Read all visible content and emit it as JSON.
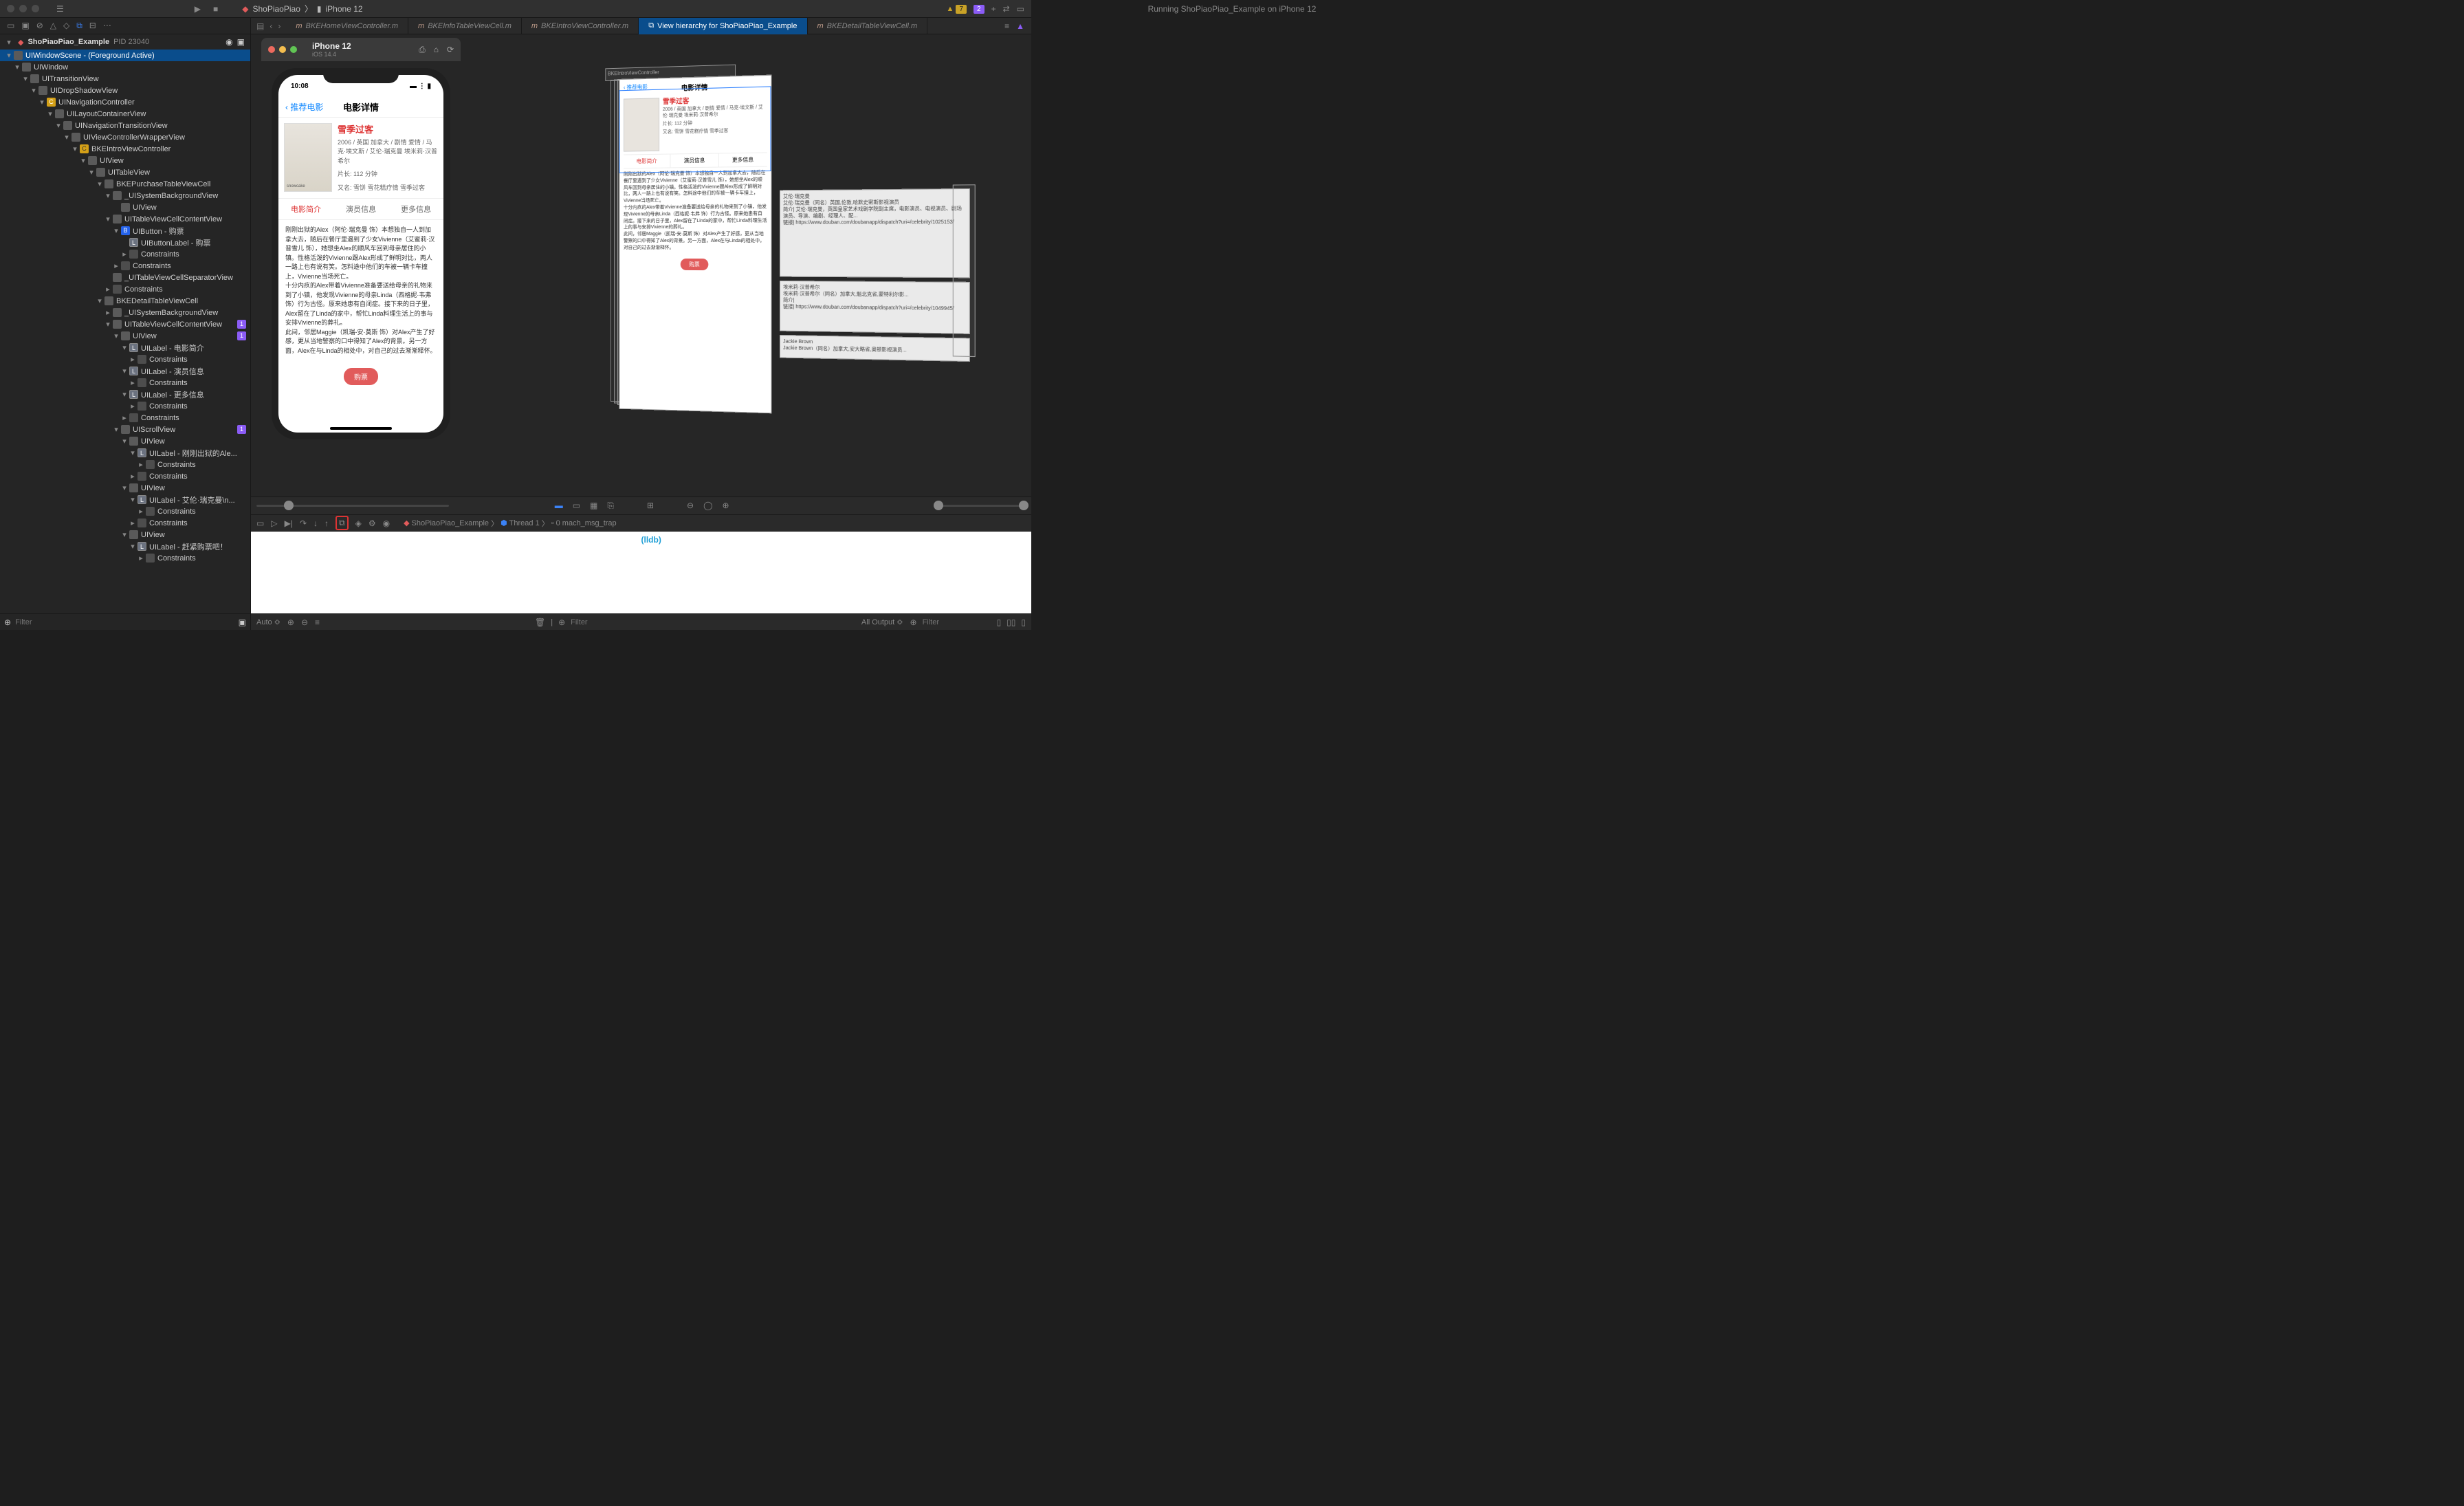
{
  "titlebar": {
    "target_app": "ShoPiaoPiao",
    "target_device": "iPhone 12",
    "status": "Running ShoPiaoPiao_Example on iPhone 12",
    "warning_count": "7",
    "issue_count": "2"
  },
  "sidebar": {
    "process": "ShoPiaoPiao_Example",
    "pid": "PID 23040",
    "tree": [
      {
        "d": 0,
        "disc": "▾",
        "ic": "v",
        "t": "UIWindowScene - (Foreground Active)",
        "sel": true
      },
      {
        "d": 1,
        "disc": "▾",
        "ic": "v",
        "t": "UIWindow"
      },
      {
        "d": 2,
        "disc": "▾",
        "ic": "v",
        "t": "UITransitionView"
      },
      {
        "d": 3,
        "disc": "▾",
        "ic": "v",
        "t": "UIDropShadowView"
      },
      {
        "d": 4,
        "disc": "▾",
        "ic": "n",
        "t": "UINavigationController"
      },
      {
        "d": 5,
        "disc": "▾",
        "ic": "v",
        "t": "UILayoutContainerView"
      },
      {
        "d": 6,
        "disc": "▾",
        "ic": "v",
        "t": "UINavigationTransitionView"
      },
      {
        "d": 7,
        "disc": "▾",
        "ic": "v",
        "t": "UIViewControllerWrapperView"
      },
      {
        "d": 8,
        "disc": "▾",
        "ic": "c",
        "t": "BKEIntroViewController"
      },
      {
        "d": 9,
        "disc": "▾",
        "ic": "v",
        "t": "UIView"
      },
      {
        "d": 10,
        "disc": "▾",
        "ic": "v",
        "t": "UITableView"
      },
      {
        "d": 11,
        "disc": "▾",
        "ic": "v",
        "t": "BKEPurchaseTableViewCell"
      },
      {
        "d": 12,
        "disc": "▾",
        "ic": "v",
        "t": "_UISystemBackgroundView"
      },
      {
        "d": 13,
        "disc": "",
        "ic": "v",
        "t": "UIView"
      },
      {
        "d": 12,
        "disc": "▾",
        "ic": "v",
        "t": "UITableViewCellContentView"
      },
      {
        "d": 13,
        "disc": "▾",
        "ic": "b",
        "t": "UIButton - 购票"
      },
      {
        "d": 14,
        "disc": "",
        "ic": "l",
        "t": "UIButtonLabel - 购票"
      },
      {
        "d": 14,
        "disc": "▸",
        "ic": "co",
        "t": "Constraints"
      },
      {
        "d": 13,
        "disc": "▸",
        "ic": "co",
        "t": "Constraints"
      },
      {
        "d": 12,
        "disc": "",
        "ic": "v",
        "t": "_UITableViewCellSeparatorView"
      },
      {
        "d": 12,
        "disc": "▸",
        "ic": "co",
        "t": "Constraints"
      },
      {
        "d": 11,
        "disc": "▾",
        "ic": "v",
        "t": "BKEDetailTableViewCell"
      },
      {
        "d": 12,
        "disc": "▸",
        "ic": "v",
        "t": "_UISystemBackgroundView"
      },
      {
        "d": 12,
        "disc": "▾",
        "ic": "v",
        "t": "UITableViewCellContentView",
        "badge": "1"
      },
      {
        "d": 13,
        "disc": "▾",
        "ic": "v",
        "t": "UIView",
        "badge": "1"
      },
      {
        "d": 14,
        "disc": "▾",
        "ic": "l",
        "t": "UILabel - 电影简介"
      },
      {
        "d": 15,
        "disc": "▸",
        "ic": "co",
        "t": "Constraints"
      },
      {
        "d": 14,
        "disc": "▾",
        "ic": "l",
        "t": "UILabel - 演员信息"
      },
      {
        "d": 15,
        "disc": "▸",
        "ic": "co",
        "t": "Constraints"
      },
      {
        "d": 14,
        "disc": "▾",
        "ic": "l",
        "t": "UILabel - 更多信息"
      },
      {
        "d": 15,
        "disc": "▸",
        "ic": "co",
        "t": "Constraints"
      },
      {
        "d": 14,
        "disc": "▸",
        "ic": "co",
        "t": "Constraints"
      },
      {
        "d": 13,
        "disc": "▾",
        "ic": "v",
        "t": "UIScrollView",
        "badge": "1"
      },
      {
        "d": 14,
        "disc": "▾",
        "ic": "v",
        "t": "UIView"
      },
      {
        "d": 15,
        "disc": "▾",
        "ic": "l",
        "t": "UILabel - 刚刚出狱的Ale..."
      },
      {
        "d": 16,
        "disc": "▸",
        "ic": "co",
        "t": "Constraints"
      },
      {
        "d": 15,
        "disc": "▸",
        "ic": "co",
        "t": "Constraints"
      },
      {
        "d": 14,
        "disc": "▾",
        "ic": "v",
        "t": "UIView"
      },
      {
        "d": 15,
        "disc": "▾",
        "ic": "l",
        "t": "UILabel - 艾伦·瑞克曼\\n..."
      },
      {
        "d": 16,
        "disc": "▸",
        "ic": "co",
        "t": "Constraints"
      },
      {
        "d": 15,
        "disc": "▸",
        "ic": "co",
        "t": "Constraints"
      },
      {
        "d": 14,
        "disc": "▾",
        "ic": "v",
        "t": "UIView"
      },
      {
        "d": 15,
        "disc": "▾",
        "ic": "l",
        "t": "UILabel - 赶紧购票吧！"
      },
      {
        "d": 16,
        "disc": "▸",
        "ic": "co",
        "t": "Constraints"
      }
    ],
    "filter_placeholder": "Filter"
  },
  "tabs": [
    {
      "label": "BKEHomeViewController.m",
      "icon": "m"
    },
    {
      "label": "BKEInfoTableViewCell.m",
      "icon": "m"
    },
    {
      "label": "BKEIntroViewController.m",
      "icon": "m"
    },
    {
      "label": "View hierarchy for ShoPiaoPiao_Example",
      "icon": "h",
      "active": true
    },
    {
      "label": "BKEDetailTableViewCell.m",
      "icon": "m"
    }
  ],
  "simulator": {
    "device": "iPhone 12",
    "os": "iOS 14.4",
    "time": "10:08",
    "nav_back": "推荐电影",
    "nav_title": "电影详情",
    "movie": {
      "title": "雪季过客",
      "meta1": "2006 / 英国 加拿大 / 剧情 爱情 / 马克·埃文斯 / 艾伦·瑞克曼 埃米莉·汉普希尔",
      "duration_label": "片长:",
      "duration": "112 分钟",
      "aka_label": "又名:",
      "aka": "雪饼 雪花糕疗情 雪季过客",
      "poster_text": "snowcake"
    },
    "tabs": [
      "电影简介",
      "演员信息",
      "更多信息"
    ],
    "synopsis": "刚刚出狱的Alex（阿伦·瑞克曼 饰）本想独自一人到加拿大去，随后在餐厅里遇到了少女Vivienne（艾蜜莉·汉普雪儿 饰），她想坐Alex的顺风车回到母亲居住的小镇。性格活泼的Vivienne跟Alex形成了鲜明对比，两人一路上也有说有笑。怎料途中他们的车被一辆卡车撞上，Vivienne当场死亡。\n十分内疚的Alex带着Vivienne准备要送给母亲的礼物来到了小镇，他发现Vivienne的母亲Linda（西格妮·韦弗 饰）行为古怪。原来她患有自闭症。接下来的日子里，Alex留在了Linda的家中，帮忙Linda料理生活上的事与安排Vivienne的葬礼。\n此间，邻居Maggie（凯瑞-安·莫斯 饰）对Alex产生了好感，更从当地警察的口中得知了Alex的背景。另一方面，Alex在与Linda的相处中，对自己的过去渐渐释怀。",
    "buy_button": "购票"
  },
  "exploded_view": {
    "nav_back": "推荐电影",
    "nav_title": "电影详情",
    "movie_title": "雪季过客",
    "meta": "2006 / 英国 加拿大 / 剧情 爱情 / 马克·埃文斯 / 艾伦·瑞克曼 埃米莉·汉普希尔",
    "duration": "片长: 112 分钟",
    "aka": "又名: 雪饼 雪花糕疗情 雪季过客",
    "tabs": [
      "电影简介",
      "演员信息",
      "更多信息"
    ],
    "buy": "购票",
    "side_panel_1": "艾伦·瑞克曼\n艾伦·瑞克曼（同名）英国,伦敦,哈默史密斯影视演员\n简介| 艾伦·瑞克曼，英国皇家艺术戏剧学院副主席，电影演员、电视演员、剧场演员、导演、编剧、经理人、配...\n链接| https://www.douban.com/doubanapp/dispatch?uri=/celebrity/1025153/",
    "side_panel_2": "埃米莉·汉普希尔\n埃米莉·汉普希尔（同名）加拿大,魁北克省,蒙特利尔影...\n简介|\n链接| https://www.douban.com/doubanapp/dispatch?uri=/celebrity/1049945/",
    "side_panel_3": "Jackie Brown\nJackie Brown（同名）加拿大,安大略省,奥顿影视演员..."
  },
  "debugbar": {
    "breadcrumb": [
      "ShoPiaoPiao_Example",
      "Thread 1",
      "0 mach_msg_trap"
    ]
  },
  "console": {
    "prompt": "(lldb)"
  },
  "bottombar": {
    "auto": "Auto ≎",
    "filter_placeholder": "Filter",
    "output": "All Output ≎"
  }
}
